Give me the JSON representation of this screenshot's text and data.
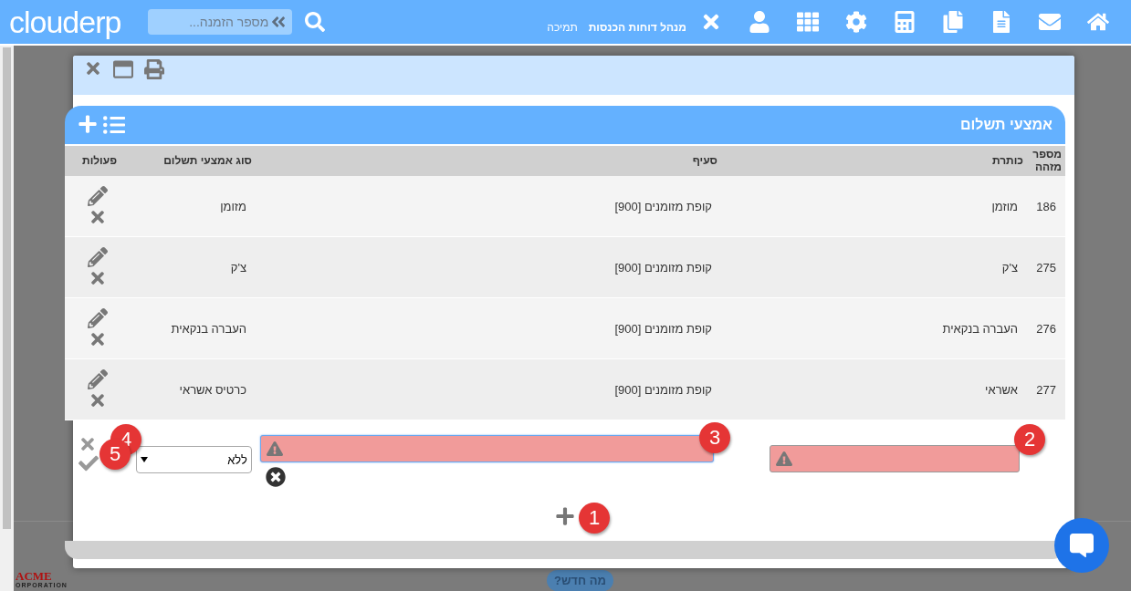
{
  "top_bar": {
    "logo": "clouderp",
    "search": {
      "placeholder": "מספר הזמנה..."
    },
    "nav_links": [
      {
        "label": "מנהל דוחות הכנסות",
        "bold": true
      },
      {
        "label": "תמיכה",
        "bold": false
      }
    ]
  },
  "background": {
    "logo": "ACME",
    "logo_sub": "ORPORATION",
    "whats_new": "מה חדש?"
  },
  "panel": {
    "title": "אמצעי תשלום",
    "columns": [
      "מספר מזהה",
      "כותרת",
      "סעיף",
      "סוג אמצעי תשלום",
      "פעולות"
    ],
    "rows": [
      {
        "id": "186",
        "title": "מוזמן",
        "section": "קופת מזומנים [900]",
        "type": "מזומן"
      },
      {
        "id": "275",
        "title": "צ'ק",
        "section": "קופת מזומנים [900]",
        "type": "צ'ק"
      },
      {
        "id": "276",
        "title": "העברה בנקאית",
        "section": "קופת מזומנים [900]",
        "type": "העברה בנקאית"
      },
      {
        "id": "277",
        "title": "אשראי",
        "section": "קופת מזומנים [900]",
        "type": "כרטיס אשראי"
      }
    ],
    "edit_row": {
      "title_field": {
        "invalid": true,
        "focused": false,
        "marker": "2"
      },
      "section_field": {
        "invalid": true,
        "focused": true,
        "marker": "3"
      },
      "type_select": {
        "value": "ללא",
        "marker": "4"
      },
      "actions": {
        "marker": "5"
      }
    },
    "add_button": {
      "marker": "1"
    }
  }
}
